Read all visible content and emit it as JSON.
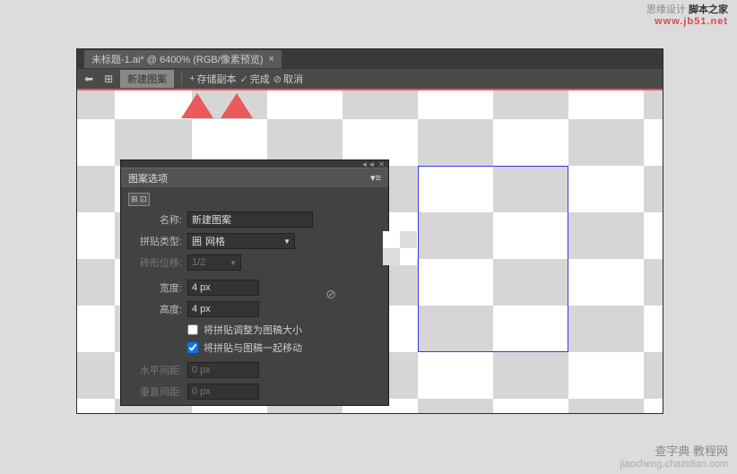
{
  "watermark": {
    "top_line1a": "思缘设计",
    "top_line1b": "脚本之家",
    "top_line2": "www.jb51.net",
    "bottom_line1": "查字典 教程网",
    "bottom_line2": "jiaocheng.chazidian.com"
  },
  "tab": {
    "title": "未标题-1.ai* @ 6400% (RGB/像素预览)",
    "close": "×"
  },
  "toolbar": {
    "back_icon": "⬅",
    "grid_icon": "⊞",
    "pattern_label": "新建图案",
    "save_copy": "存储副本",
    "done": "完成",
    "cancel": "取消"
  },
  "panel": {
    "title": "图案选项",
    "name_label": "名称:",
    "name_value": "新建图案",
    "tile_type_label": "拼贴类型:",
    "tile_type_value": "网格",
    "tile_type_icon": "囲",
    "brick_offset_label": "砖形位移:",
    "brick_offset_value": "1/2",
    "width_label": "宽度:",
    "width_value": "4 px",
    "height_label": "高度:",
    "height_value": "4 px",
    "checkbox1": "将拼贴调整为图稿大小",
    "checkbox2": "将拼贴与图稿一起移动",
    "h_spacing_label": "水平间距:",
    "h_spacing_value": "0 px",
    "v_spacing_label": "垂直间距:",
    "v_spacing_value": "0 px"
  },
  "colors": {
    "accent_red": "#e85858",
    "panel_bg": "#424242",
    "selection_blue": "#3838e8"
  }
}
